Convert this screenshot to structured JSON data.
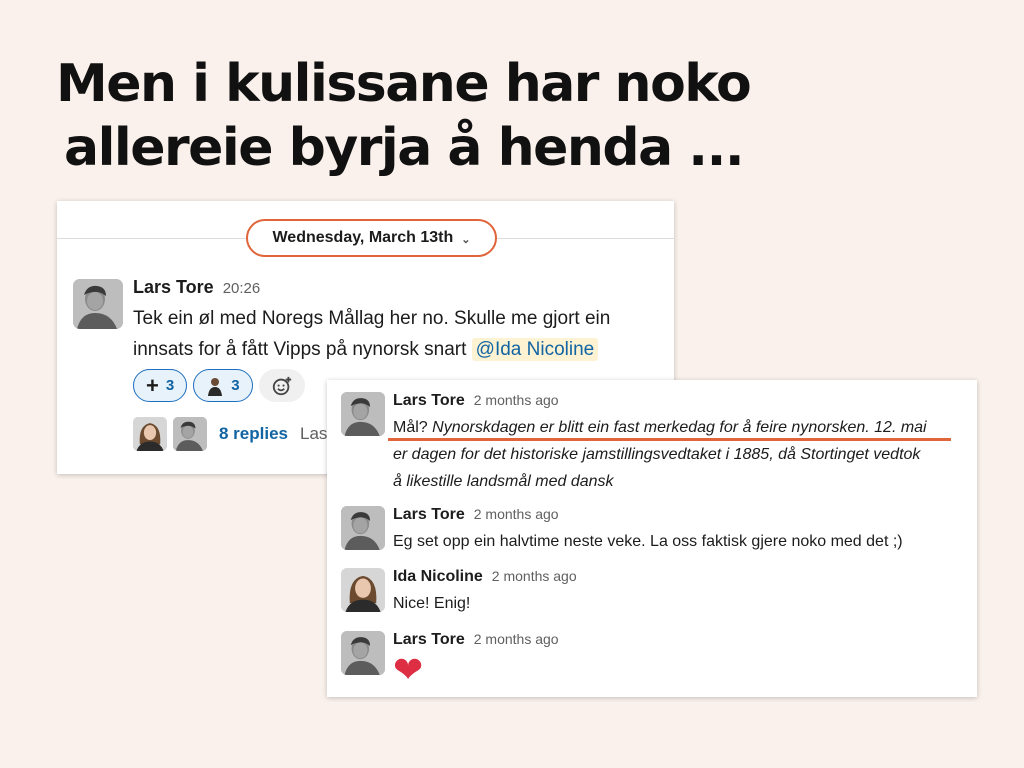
{
  "slide": {
    "title_line1": "Men i kulissane har noko",
    "title_line2": "allereie byrja å henda ..."
  },
  "main_message": {
    "date_label": "Wednesday, March 13th",
    "author": "Lars Tore",
    "time": "20:26",
    "text_line1": "Tek ein øl med Noregs Mållag her no. Skulle me gjort ein",
    "text_line2": "innsats for å fått Vipps på nynorsk snart",
    "mention": "@Ida Nicoline",
    "reactions": [
      {
        "emoji": "heavy-plus-sign",
        "count": "3"
      },
      {
        "emoji": "person-emoji",
        "count": "3"
      }
    ],
    "replies_label": "8 replies",
    "replies_meta": "Last"
  },
  "thread": [
    {
      "author": "Lars Tore",
      "time": "2 months ago",
      "prefix": "Mål?",
      "line1": "Nynorskdagen er blitt ein fast merkedag for å feire nynorsken. 12. mai",
      "line2": "er dagen for det historiske jamstillingsvedtaket i 1885, då Stortinget vedtok",
      "line3": "å likestille landsmål med dansk"
    },
    {
      "author": "Lars Tore",
      "time": "2 months ago",
      "text": "Eg set opp ein halvtime neste veke. La oss faktisk gjere noko med det ;)"
    },
    {
      "author": "Ida Nicoline",
      "time": "2 months ago",
      "text": "Nice! Enig!"
    },
    {
      "author": "Lars Tore",
      "time": "2 months ago",
      "emoji": "❤"
    }
  ],
  "colors": {
    "background": "#faf1ec",
    "highlight": "#e0653a",
    "link": "#1264a3",
    "mention_bg": "#fdf3d3"
  }
}
